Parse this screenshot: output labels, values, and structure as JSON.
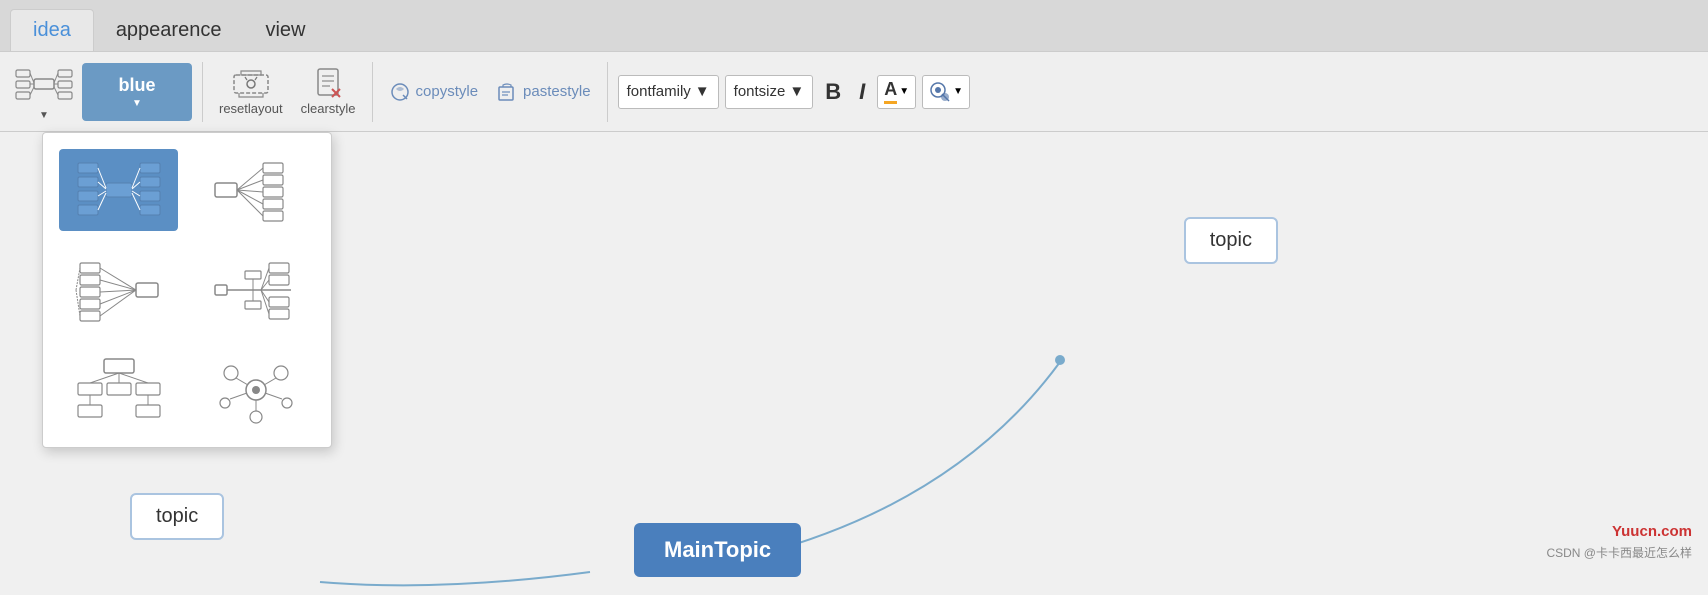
{
  "tabs": [
    {
      "label": "idea",
      "active": true
    },
    {
      "label": "appearence",
      "active": false
    },
    {
      "label": "view",
      "active": false
    }
  ],
  "toolbar": {
    "color_button_label": "blue",
    "resetlayout_label": "resetlayout",
    "clearstyle_label": "clearstyle",
    "copystyle_label": "copystyle",
    "pastestyle_label": "pastestyle",
    "fontfamily_label": "fontfamily",
    "fontsize_label": "fontsize",
    "bold_label": "B",
    "italic_label": "I",
    "text_color_label": "A",
    "bg_color_label": ""
  },
  "dropdown": {
    "visible": true,
    "options": [
      {
        "id": "mindmap-center",
        "selected": true
      },
      {
        "id": "mindmap-right"
      },
      {
        "id": "mindmap-left"
      },
      {
        "id": "mindmap-fishbone"
      },
      {
        "id": "mindmap-tree"
      },
      {
        "id": "mindmap-bubble"
      }
    ]
  },
  "canvas": {
    "main_topic_label": "MainTopic",
    "topic_right_label": "topic",
    "topic_left_label": "topic"
  },
  "watermark": {
    "line1": "Yuucn.com",
    "line2": "CSDN @卡卡西最近怎么样"
  }
}
